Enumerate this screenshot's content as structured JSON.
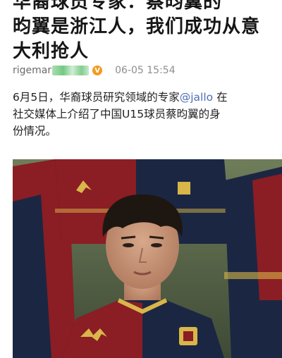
{
  "headline": {
    "line1": "华裔球员专家：蔡昀翼的",
    "line2": "昀翼是浙江人，我们成功从意",
    "line3": "大利抢人"
  },
  "meta": {
    "author_name": "rigemar",
    "verified_mark": "V",
    "timestamp": "06-05 15:54"
  },
  "article": {
    "line1_pre": "6月5日，华裔球员研究领域的专家",
    "mention": "@jallo",
    "line1_post": " 在",
    "line2": "社交媒体上介绍了中国U15球员蔡昀翼的身",
    "line3": "份情况。"
  },
  "photo": {
    "kit_primary": "#8b1d24",
    "kit_secondary": "#1b2742",
    "badge_color": "#d9b64a"
  }
}
